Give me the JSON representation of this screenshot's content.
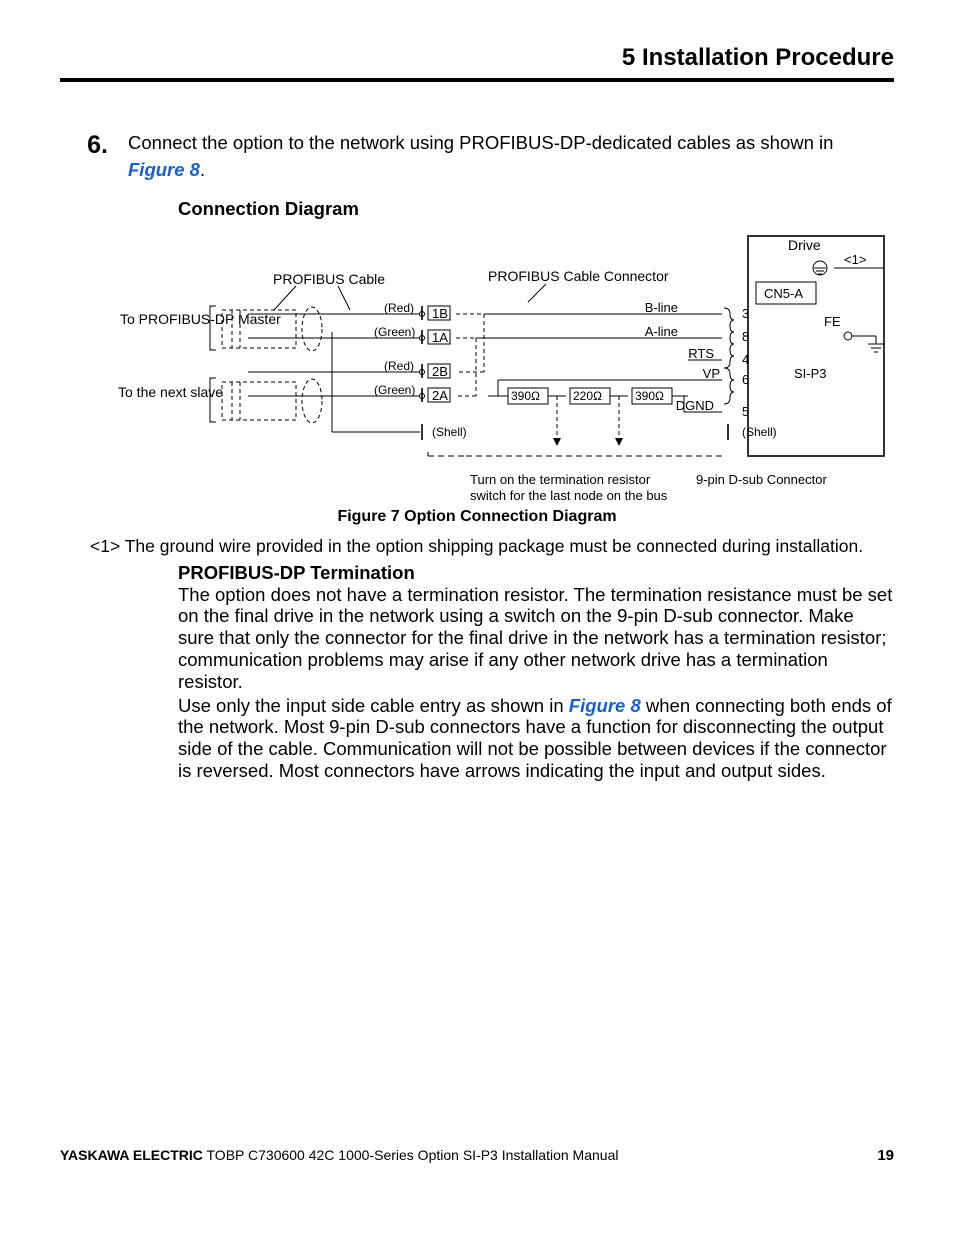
{
  "header": {
    "title": "5  Installation Procedure"
  },
  "step": {
    "number": "6.",
    "text_part1": "Connect the option to the network using PROFIBUS-DP-dedicated cables as shown in ",
    "figref1": "Figure 8",
    "text_part2": "."
  },
  "connection_heading": "Connection Diagram",
  "diagram": {
    "profibus_cable": "PROFIBUS Cable",
    "profibus_conn": "PROFIBUS Cable Connector",
    "to_master": "To PROFIBUS-DP Master",
    "to_next": "To the next slave",
    "red": "(Red)",
    "green": "(Green)",
    "shell": "(Shell)",
    "p1b": "1B",
    "p1a": "1A",
    "p2b": "2B",
    "p2a": "2A",
    "r390a": "390",
    "r220": "220",
    "r390b": "390",
    "ohm": "Ω",
    "bline": "B-line",
    "aline": "A-line",
    "rts": "RTS",
    "vp": "VP",
    "dgnd": "DGND",
    "pin3": "3",
    "pin8": "8",
    "pin4": "4",
    "pin6": "6",
    "pin5": "5",
    "drive": "Drive",
    "marker1": "<1>",
    "cn5a": "CN5-A",
    "fe": "FE",
    "sip3": "SI-P3",
    "term_note1": "Turn on the termination resistor",
    "term_note2": "switch for the last node on the bus",
    "dsub": "9-pin D-sub Connector"
  },
  "fig_caption": "Figure 7  Option Connection Diagram",
  "note1": "<1> The ground wire provided in the option shipping package must be connected during installation.",
  "profibus_heading": "PROFIBUS-DP Termination",
  "para1": "The option does not have a termination resistor. The termination resistance must be set on the final drive in the network using a switch on the 9-pin D-sub connector. Make sure that only the connector for the final drive in the network has a termination resistor; communication problems may arise if any other network drive has a termination resistor.",
  "para2_a": "Use only the input side cable entry as shown in ",
  "para2_ref": "Figure 8",
  "para2_b": " when connecting both ends of the network. Most 9-pin D-sub connectors have a function for disconnecting the output side of the cable. Communication will not be possible between devices if the connector is reversed. Most connectors have arrows indicating the input and output sides.",
  "footer": {
    "company": "YASKAWA ELECTRIC",
    "doc": " TOBP C730600 42C 1000-Series Option SI-P3 Installation Manual",
    "page": "19"
  }
}
